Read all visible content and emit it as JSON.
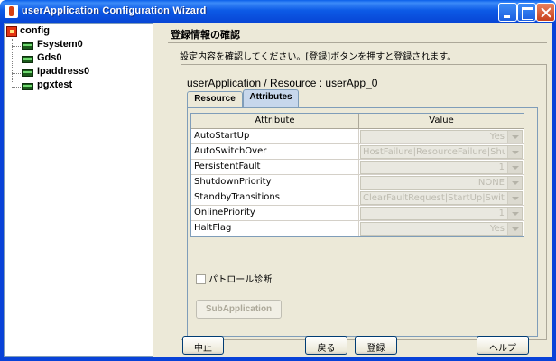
{
  "window": {
    "title": "userApplication Configuration Wizard"
  },
  "tree": {
    "root": "config",
    "items": [
      {
        "label": "Fsystem0"
      },
      {
        "label": "Gds0"
      },
      {
        "label": "Ipaddress0"
      },
      {
        "label": "pgxtest"
      }
    ]
  },
  "main": {
    "heading": "登録情報の確認",
    "description": "設定内容を確認してください。[登録]ボタンを押すと登録されます。",
    "resource_title": "userApplication / Resource  :  userApp_0",
    "tabs": [
      {
        "label": "Resource",
        "selected": false
      },
      {
        "label": "Attributes",
        "selected": true
      }
    ],
    "table": {
      "headers": [
        "Attribute",
        "Value"
      ],
      "rows": [
        {
          "attribute": "AutoStartUp",
          "value": "Yes"
        },
        {
          "attribute": "AutoSwitchOver",
          "value": "HostFailure|ResourceFailure|Shut..."
        },
        {
          "attribute": "PersistentFault",
          "value": "1"
        },
        {
          "attribute": "ShutdownPriority",
          "value": "NONE"
        },
        {
          "attribute": "StandbyTransitions",
          "value": "ClearFaultRequest|StartUp|Switch..."
        },
        {
          "attribute": "OnlinePriority",
          "value": "1"
        },
        {
          "attribute": "HaltFlag",
          "value": "Yes"
        }
      ]
    },
    "patrol_label": "パトロール診断",
    "patrol_checked": false,
    "subapp_label": "SubApplication"
  },
  "buttons": {
    "abort": "中止",
    "back": "戻る",
    "register": "登録",
    "help": "ヘルプ"
  }
}
